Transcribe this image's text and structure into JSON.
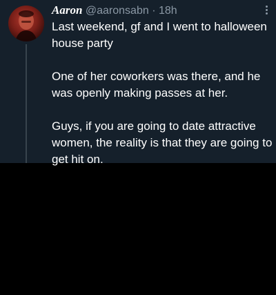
{
  "tweet": {
    "display_name": "Aaron",
    "handle": "@aaronsabn",
    "separator": "·",
    "time": "18h",
    "paragraphs": [
      "Last weekend, gf and I went to halloween house party",
      "One of her coworkers was there, and he was openly making passes at her.",
      "Guys, if you are going to date attractive women, the reality is that they are going to get hit on."
    ]
  },
  "colors": {
    "tweet_background": "#15202b",
    "page_background": "#000000",
    "primary_text": "#ffffff",
    "secondary_text": "#8b98a5",
    "thread_line": "#38444d"
  },
  "icons": {
    "more": "more-vertical-icon",
    "avatar": "avatar"
  }
}
